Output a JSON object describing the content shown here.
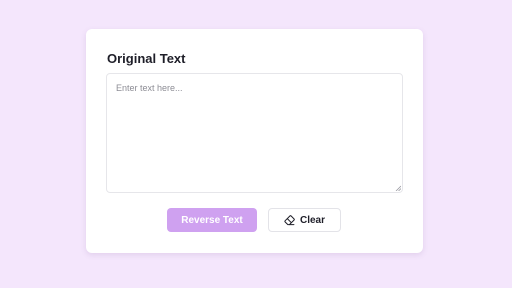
{
  "card": {
    "title": "Original Text",
    "input": {
      "value": "",
      "placeholder": "Enter text here..."
    },
    "buttons": {
      "reverse_label": "Reverse Text",
      "clear_label": "Clear",
      "clear_icon": "eraser-icon"
    }
  },
  "colors": {
    "background": "#f4e6fc",
    "card": "#ffffff",
    "accent": "#cfa1f0",
    "text": "#1e1e28"
  }
}
